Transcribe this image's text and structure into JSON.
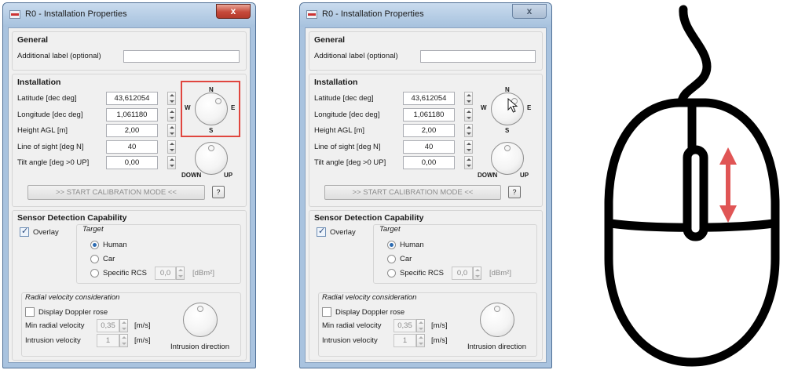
{
  "dialog": {
    "title": "R0 - Installation Properties",
    "close_glyph": "x",
    "general": {
      "header": "General",
      "additional_label": "Additional label (optional)",
      "additional_value": ""
    },
    "installation": {
      "header": "Installation",
      "latitude_label": "Latitude [dec deg]",
      "latitude_value": "43,612054",
      "longitude_label": "Longitude [dec deg]",
      "longitude_value": "1,061180",
      "height_label": "Height AGL [m]",
      "height_value": "2,00",
      "los_label": "Line of sight [deg N]",
      "los_value": "40",
      "tilt_label": "Tilt angle [deg >0 UP]",
      "tilt_value": "0,00",
      "compass": {
        "n": "N",
        "s": "S",
        "w": "W",
        "e": "E"
      },
      "tilt_knob": {
        "down": "DOWN",
        "up": "UP"
      },
      "calibration_button": ">> START CALIBRATION MODE <<",
      "help_button": "?"
    },
    "sensor": {
      "header": "Sensor Detection Capability",
      "overlay_label": "Overlay",
      "overlay_checked": true,
      "target_label": "Target",
      "options": [
        "Human",
        "Car",
        "Specific RCS"
      ],
      "selected": "Human",
      "rcs_value": "0,0",
      "rcs_unit": "[dBm²]"
    },
    "radial": {
      "header": "Radial velocity consideration",
      "doppler_label": "Display Doppler rose",
      "doppler_checked": false,
      "min_label": "Min radial velocity",
      "min_value": "0,35",
      "min_unit": "[m/s]",
      "intrusion_label": "Intrusion velocity",
      "intrusion_value": "1",
      "intrusion_unit": "[m/s]",
      "direction_label": "Intrusion direction"
    }
  },
  "colors": {
    "highlight": "#e0463f",
    "arrow": "#e05555"
  },
  "icons": {
    "left_marker": "red-highlight-box",
    "right_marker": "pointer-cursor-icon",
    "mouse": "mouse-scroll-wheel-icon"
  }
}
